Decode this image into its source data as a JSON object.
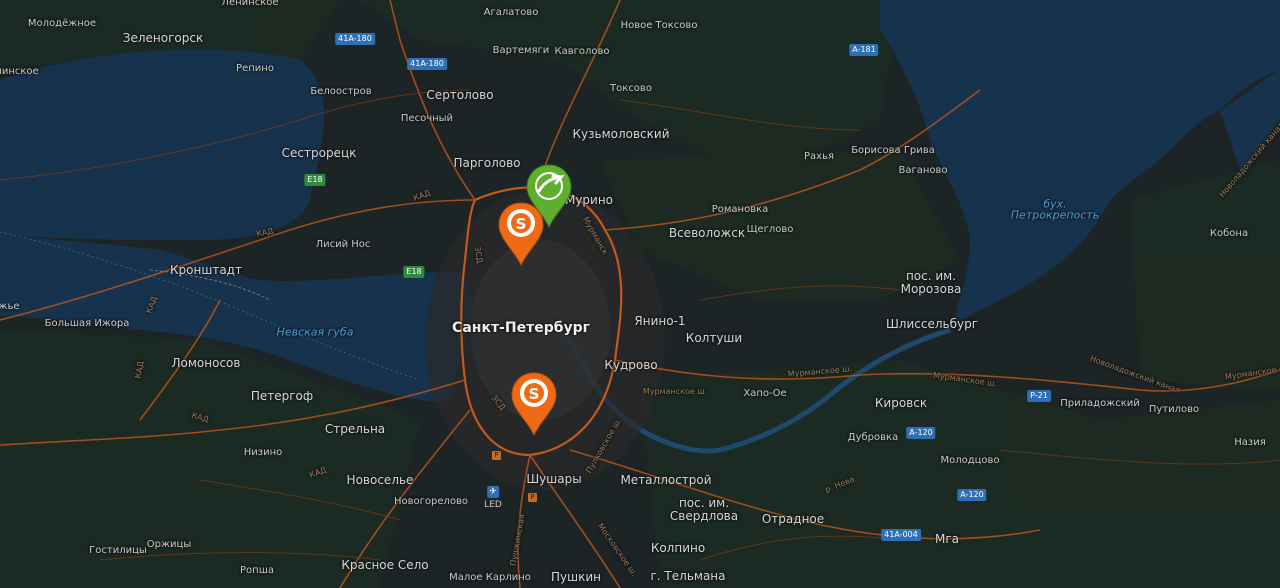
{
  "map": {
    "labels": [
      {
        "id": "moldozhnoe",
        "text": "Молодёжное",
        "cls": ""
      },
      {
        "id": "zelenogorsk",
        "text": "Зеленогорск",
        "cls": "town"
      },
      {
        "id": "repino",
        "text": "Репино",
        "cls": ""
      },
      {
        "id": "ninskoe",
        "text": "нинское",
        "cls": ""
      },
      {
        "id": "beloostrov",
        "text": "Белоостров",
        "cls": ""
      },
      {
        "id": "sertolovo",
        "text": "Сертолово",
        "cls": "town"
      },
      {
        "id": "pesochny",
        "text": "Песочный",
        "cls": ""
      },
      {
        "id": "agalatovo",
        "text": "Агалатово",
        "cls": ""
      },
      {
        "id": "vartemyagi",
        "text": "Вартемяги",
        "cls": ""
      },
      {
        "id": "kavgolovo",
        "text": "Кавголово",
        "cls": ""
      },
      {
        "id": "novoe_toksovo",
        "text": "Новое Токсово",
        "cls": ""
      },
      {
        "id": "toksovo",
        "text": "Токсово",
        "cls": ""
      },
      {
        "id": "kuzmolovsky",
        "text": "Кузьмоловский",
        "cls": "town"
      },
      {
        "id": "sestroretsk",
        "text": "Сестрорецк",
        "cls": "town"
      },
      {
        "id": "pargolovo",
        "text": "Парголово",
        "cls": "town"
      },
      {
        "id": "murino",
        "text": "Мурино",
        "cls": "town"
      },
      {
        "id": "razya",
        "text": "Рахья",
        "cls": ""
      },
      {
        "id": "borisova_griva",
        "text": "Борисова Грива",
        "cls": ""
      },
      {
        "id": "vaganovo",
        "text": "Ваганово",
        "cls": ""
      },
      {
        "id": "romanovka",
        "text": "Романовка",
        "cls": ""
      },
      {
        "id": "vsevolozhsk",
        "text": "Всеволожск",
        "cls": "town"
      },
      {
        "id": "shcheglovo",
        "text": "Щеглово",
        "cls": ""
      },
      {
        "id": "lisiy_nos",
        "text": "Лисий Нос",
        "cls": ""
      },
      {
        "id": "kronshtadt",
        "text": "Кронштадт",
        "cls": "town"
      },
      {
        "id": "zhye",
        "text": "жье",
        "cls": ""
      },
      {
        "id": "bolshaya_izhora",
        "text": "Большая Ижора",
        "cls": ""
      },
      {
        "id": "nevskaya_guba",
        "text": "Невская губа",
        "cls": "water"
      },
      {
        "id": "spb",
        "text": "Санкт-Петербург",
        "cls": "city"
      },
      {
        "id": "yanino",
        "text": "Янино-1",
        "cls": "town"
      },
      {
        "id": "koltushi",
        "text": "Колтуши",
        "cls": "town"
      },
      {
        "id": "pos_morozova",
        "text": "пос. им.",
        "cls": "town"
      },
      {
        "id": "pos_morozova2",
        "text": "Морозова",
        "cls": "town"
      },
      {
        "id": "shlisselburg",
        "text": "Шлиссельбург",
        "cls": "town"
      },
      {
        "id": "bukh_petro",
        "text": "бух.",
        "cls": "water"
      },
      {
        "id": "bukh_petro2",
        "text": "Петрокрепость",
        "cls": "water"
      },
      {
        "id": "kobona",
        "text": "Кобона",
        "cls": ""
      },
      {
        "id": "lomonosov",
        "text": "Ломоносов",
        "cls": "town"
      },
      {
        "id": "kudrovo",
        "text": "Кудрово",
        "cls": "town"
      },
      {
        "id": "petergof",
        "text": "Петергоф",
        "cls": "town"
      },
      {
        "id": "khapo_oe",
        "text": "Хапо-Ое",
        "cls": ""
      },
      {
        "id": "kirovsk",
        "text": "Кировск",
        "cls": "town"
      },
      {
        "id": "prilyadozhsky",
        "text": "Приладожский",
        "cls": ""
      },
      {
        "id": "putilovo",
        "text": "Путилово",
        "cls": ""
      },
      {
        "id": "strelna",
        "text": "Стрельна",
        "cls": "town"
      },
      {
        "id": "dubrovka",
        "text": "Дубровка",
        "cls": ""
      },
      {
        "id": "nazia",
        "text": "Назия",
        "cls": ""
      },
      {
        "id": "nizino",
        "text": "Низино",
        "cls": ""
      },
      {
        "id": "molodtsovo",
        "text": "Молодцово",
        "cls": ""
      },
      {
        "id": "novoselye",
        "text": "Новоселье",
        "cls": "town"
      },
      {
        "id": "shushary",
        "text": "Шушары",
        "cls": "town"
      },
      {
        "id": "metallostroy",
        "text": "Металлострой",
        "cls": "town"
      },
      {
        "id": "novogorelovo",
        "text": "Новогорелово",
        "cls": ""
      },
      {
        "id": "pos_sverdlova",
        "text": "пос. им.",
        "cls": "town"
      },
      {
        "id": "pos_sverdlova2",
        "text": "Свердлова",
        "cls": "town"
      },
      {
        "id": "otradnoe",
        "text": "Отрадное",
        "cls": "town"
      },
      {
        "id": "gostilitsy",
        "text": "Гостилицы",
        "cls": ""
      },
      {
        "id": "orzhitsy",
        "text": "Оржицы",
        "cls": ""
      },
      {
        "id": "kolpino",
        "text": "Колпино",
        "cls": "town"
      },
      {
        "id": "mga",
        "text": "Мга",
        "cls": "town"
      },
      {
        "id": "ropsha",
        "text": "Ропша",
        "cls": ""
      },
      {
        "id": "krasnoe_selo",
        "text": "Красное Село",
        "cls": "town"
      },
      {
        "id": "maloe_karlino",
        "text": "Малое Карлино",
        "cls": ""
      },
      {
        "id": "pushkin",
        "text": "Пушкин",
        "cls": "town"
      },
      {
        "id": "g_telmana",
        "text": "г. Тельмана",
        "cls": "town"
      },
      {
        "id": "lenins",
        "text": "Ленинское",
        "cls": ""
      }
    ],
    "road_labels": [
      {
        "id": "kad1",
        "text": "КАД"
      },
      {
        "id": "kad2",
        "text": "КАД"
      },
      {
        "id": "kad3",
        "text": "КАД"
      },
      {
        "id": "kad4",
        "text": "КАД"
      },
      {
        "id": "kad5",
        "text": "КАД"
      },
      {
        "id": "kad6",
        "text": "КАД"
      },
      {
        "id": "zsd1",
        "text": "ЗСД"
      },
      {
        "id": "zsd2",
        "text": "ЗСД"
      },
      {
        "id": "murm1",
        "text": "Мурманское ш."
      },
      {
        "id": "murm2",
        "text": "Мурманское ш."
      },
      {
        "id": "murm3",
        "text": "Мурманское ш."
      },
      {
        "id": "murm4",
        "text": "Мурманское ш."
      },
      {
        "id": "murm5",
        "text": "Мурманск"
      },
      {
        "id": "neva",
        "text": "р. Нева"
      },
      {
        "id": "novoladoga1",
        "text": "Новоладожский канал"
      },
      {
        "id": "novoladoga2",
        "text": "Новоладожский канал"
      },
      {
        "id": "pulk",
        "text": "Пулковское ш."
      },
      {
        "id": "moskov",
        "text": "Московское ш."
      },
      {
        "id": "pushk",
        "text": "Пушкинская"
      }
    ],
    "shields": [
      {
        "id": "a180",
        "text": "41A-180",
        "color": "blue"
      },
      {
        "id": "a180b",
        "text": "41A-180",
        "color": "blue"
      },
      {
        "id": "a181",
        "text": "A-181",
        "color": "blue"
      },
      {
        "id": "e18a",
        "text": "E18",
        "color": "green"
      },
      {
        "id": "e18b",
        "text": "E18",
        "color": "green"
      },
      {
        "id": "p21",
        "text": "P-21",
        "color": "blue"
      },
      {
        "id": "a120a",
        "text": "A-120",
        "color": "blue"
      },
      {
        "id": "a120b",
        "text": "A-120",
        "color": "blue"
      },
      {
        "id": "a004",
        "text": "41A-004",
        "color": "blue"
      }
    ],
    "airport": {
      "label": "LED"
    },
    "parking": {
      "symbol": "P"
    },
    "pins": [
      {
        "id": "pin-green",
        "kind": "shop-logo",
        "color": "#5fae2e"
      },
      {
        "id": "pin-orange-1",
        "kind": "S-logo",
        "color": "#ef6a17"
      },
      {
        "id": "pin-orange-2",
        "kind": "S-logo",
        "color": "#ef6a17"
      }
    ]
  }
}
